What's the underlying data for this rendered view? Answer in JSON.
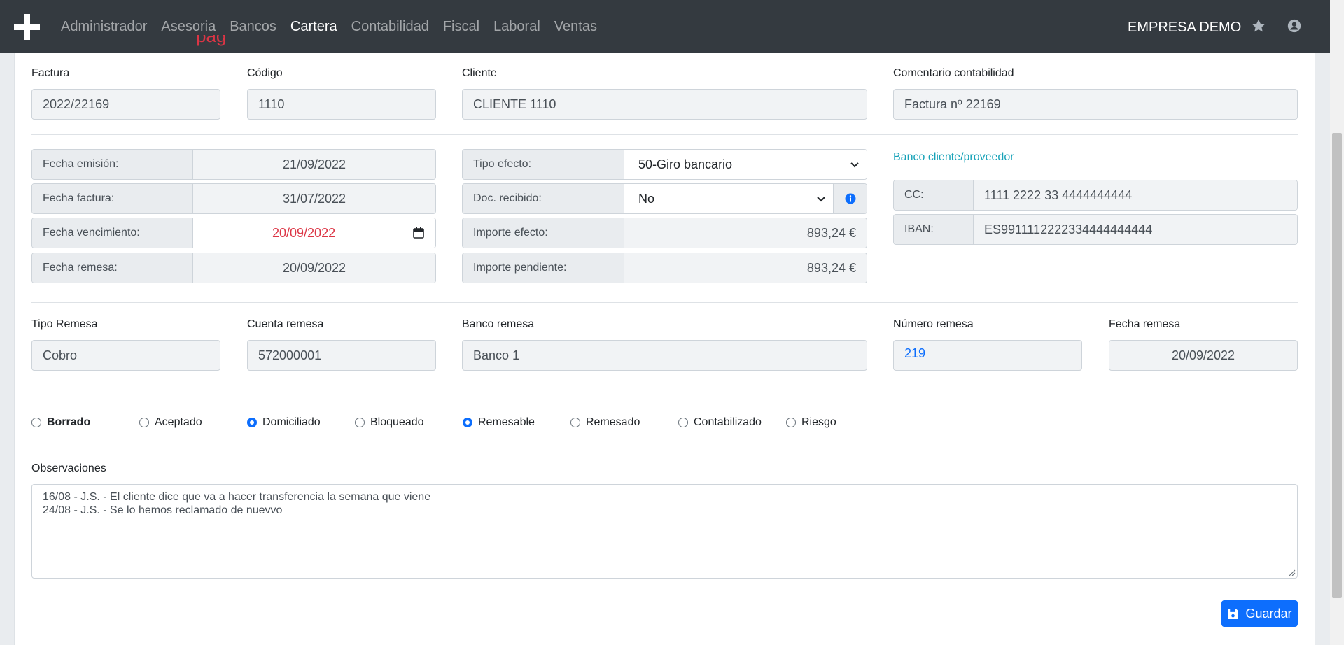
{
  "nav": {
    "menu": [
      "Administrador",
      "Asesoria",
      "Bancos",
      "Cartera",
      "Contabilidad",
      "Fiscal",
      "Laboral",
      "Ventas"
    ],
    "active": "Cartera",
    "company": "EMPRESA DEMO",
    "icons": [
      "plus-logo-icon",
      "star-icon",
      "user-icon"
    ]
  },
  "invoice": {
    "factura_label": "Factura",
    "factura": "2022/22169",
    "codigo_label": "Código",
    "codigo": "1110",
    "cliente_label": "Cliente",
    "cliente": "CLIENTE 1110",
    "comentario_label": "Comentario contabilidad",
    "comentario": "Factura nº 22169"
  },
  "dates": {
    "emision_label": "Fecha emisión:",
    "emision": "21/09/2022",
    "factura_label": "Fecha factura:",
    "factura": "31/07/2022",
    "vencimiento_label": "Fecha vencimiento:",
    "vencimiento": "20/09/2022",
    "remesa_label": "Fecha remesa:",
    "remesa": "20/09/2022"
  },
  "efecto": {
    "tipo_label": "Tipo efecto:",
    "tipo": "50-Giro bancario",
    "doc_label": "Doc. recibido:",
    "doc": "No",
    "importe_label": "Importe efecto:",
    "importe": "893,24 €",
    "pendiente_label": "Importe pendiente:",
    "pendiente": "893,24 €"
  },
  "banco": {
    "link": "Banco cliente/proveedor",
    "cc_label": "CC:",
    "cc": "1111 2222 33 4444444444",
    "iban_label": "IBAN:",
    "iban": "ES9911112222334444444444"
  },
  "remesa": {
    "tipo_label": "Tipo Remesa",
    "tipo": "Cobro",
    "cuenta_label": "Cuenta remesa",
    "cuenta": "572000001",
    "banco_label": "Banco remesa",
    "banco": "Banco 1",
    "numero_label": "Número remesa",
    "numero": "219",
    "fecha_label": "Fecha remesa",
    "fecha": "20/09/2022"
  },
  "status": [
    {
      "label": "Borrado",
      "checked": false
    },
    {
      "label": "Aceptado",
      "checked": false
    },
    {
      "label": "Domiciliado",
      "checked": true
    },
    {
      "label": "Bloqueado",
      "checked": false
    },
    {
      "label": "Remesable",
      "checked": true
    },
    {
      "label": "Remesado",
      "checked": false
    },
    {
      "label": "Contabilizado",
      "checked": false
    },
    {
      "label": "Riesgo",
      "checked": false
    }
  ],
  "observaciones": {
    "label": "Observaciones",
    "line1": "16/08 - J.S. - El cliente dice que va a hacer transferencia la semana que viene",
    "line2": "24/08 - J.S. - Se lo hemos reclamado de nuevvo"
  },
  "actions": {
    "save": "Guardar"
  },
  "colors": {
    "primary": "#0d6efd",
    "navbar": "#343a40",
    "danger": "#dc3545",
    "info": "#17a2b8"
  }
}
